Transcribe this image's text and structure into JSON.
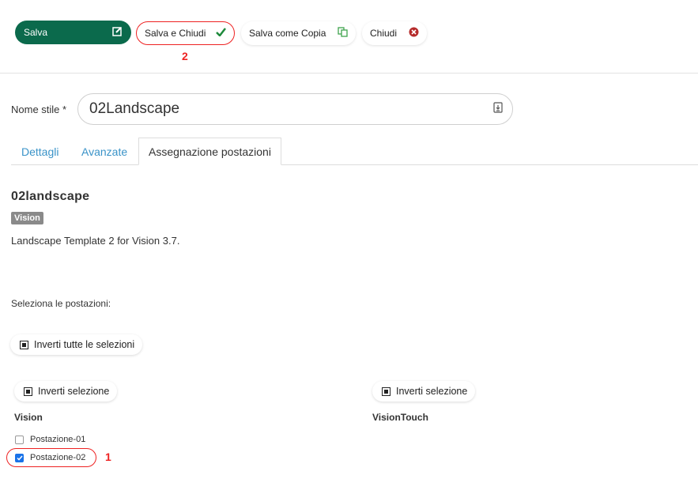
{
  "toolbar": {
    "save_label": "Salva",
    "save_close_label": "Salva e Chiudi",
    "save_copy_label": "Salva come Copia",
    "close_label": "Chiudi"
  },
  "annotations": {
    "step1": "1",
    "step2": "2"
  },
  "form": {
    "name_label": "Nome stile *",
    "name_value": "02Landscape"
  },
  "tabs": [
    {
      "label": "Dettagli",
      "active": false
    },
    {
      "label": "Avanzate",
      "active": false
    },
    {
      "label": "Assegnazione postazioni",
      "active": true
    }
  ],
  "style": {
    "title": "02landscape",
    "badge": "Vision",
    "description": "Landscape Template 2 for Vision 3.7."
  },
  "assignment": {
    "select_label": "Seleziona le postazioni:",
    "invert_all_label": "Inverti tutte le selezioni",
    "groups": [
      {
        "name": "Vision",
        "invert_label": "Inverti selezione",
        "stations": [
          {
            "label": "Postazione-01",
            "checked": false
          },
          {
            "label": "Postazione-02",
            "checked": true
          }
        ]
      },
      {
        "name": "VisionTouch",
        "invert_label": "Inverti selezione",
        "stations": []
      }
    ]
  },
  "colors": {
    "primary": "#0b6a4c",
    "link": "#3a93c8",
    "highlight": "#e22222",
    "checkbox": "#1a73e8"
  }
}
